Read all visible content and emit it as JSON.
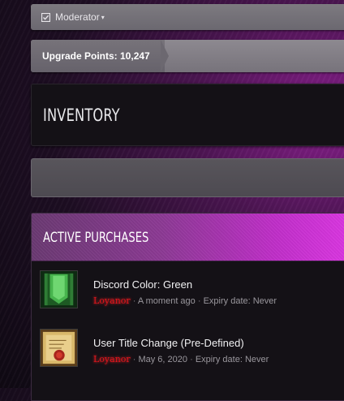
{
  "top_panel": {
    "moderator_label": "Moderator",
    "caret": "▾",
    "checkbox": "☑"
  },
  "points": {
    "label": "Upgrade Points: 10,247"
  },
  "inventory": {
    "title": "INVENTORY"
  },
  "active": {
    "title": "ACTIVE PURCHASES",
    "items": [
      {
        "name": "Discord Color: Green",
        "user": "Loyanor",
        "time": "A moment ago",
        "expiry": "Expiry date: Never",
        "icon": "green-banner-icon"
      },
      {
        "name": "User Title Change (Pre-Defined)",
        "user": "Loyanor",
        "time": "May 6, 2020",
        "expiry": "Expiry date: Never",
        "icon": "scroll-seal-icon"
      }
    ]
  },
  "colors": {
    "accent": "#df38e6",
    "user_name": "#e0141c"
  }
}
